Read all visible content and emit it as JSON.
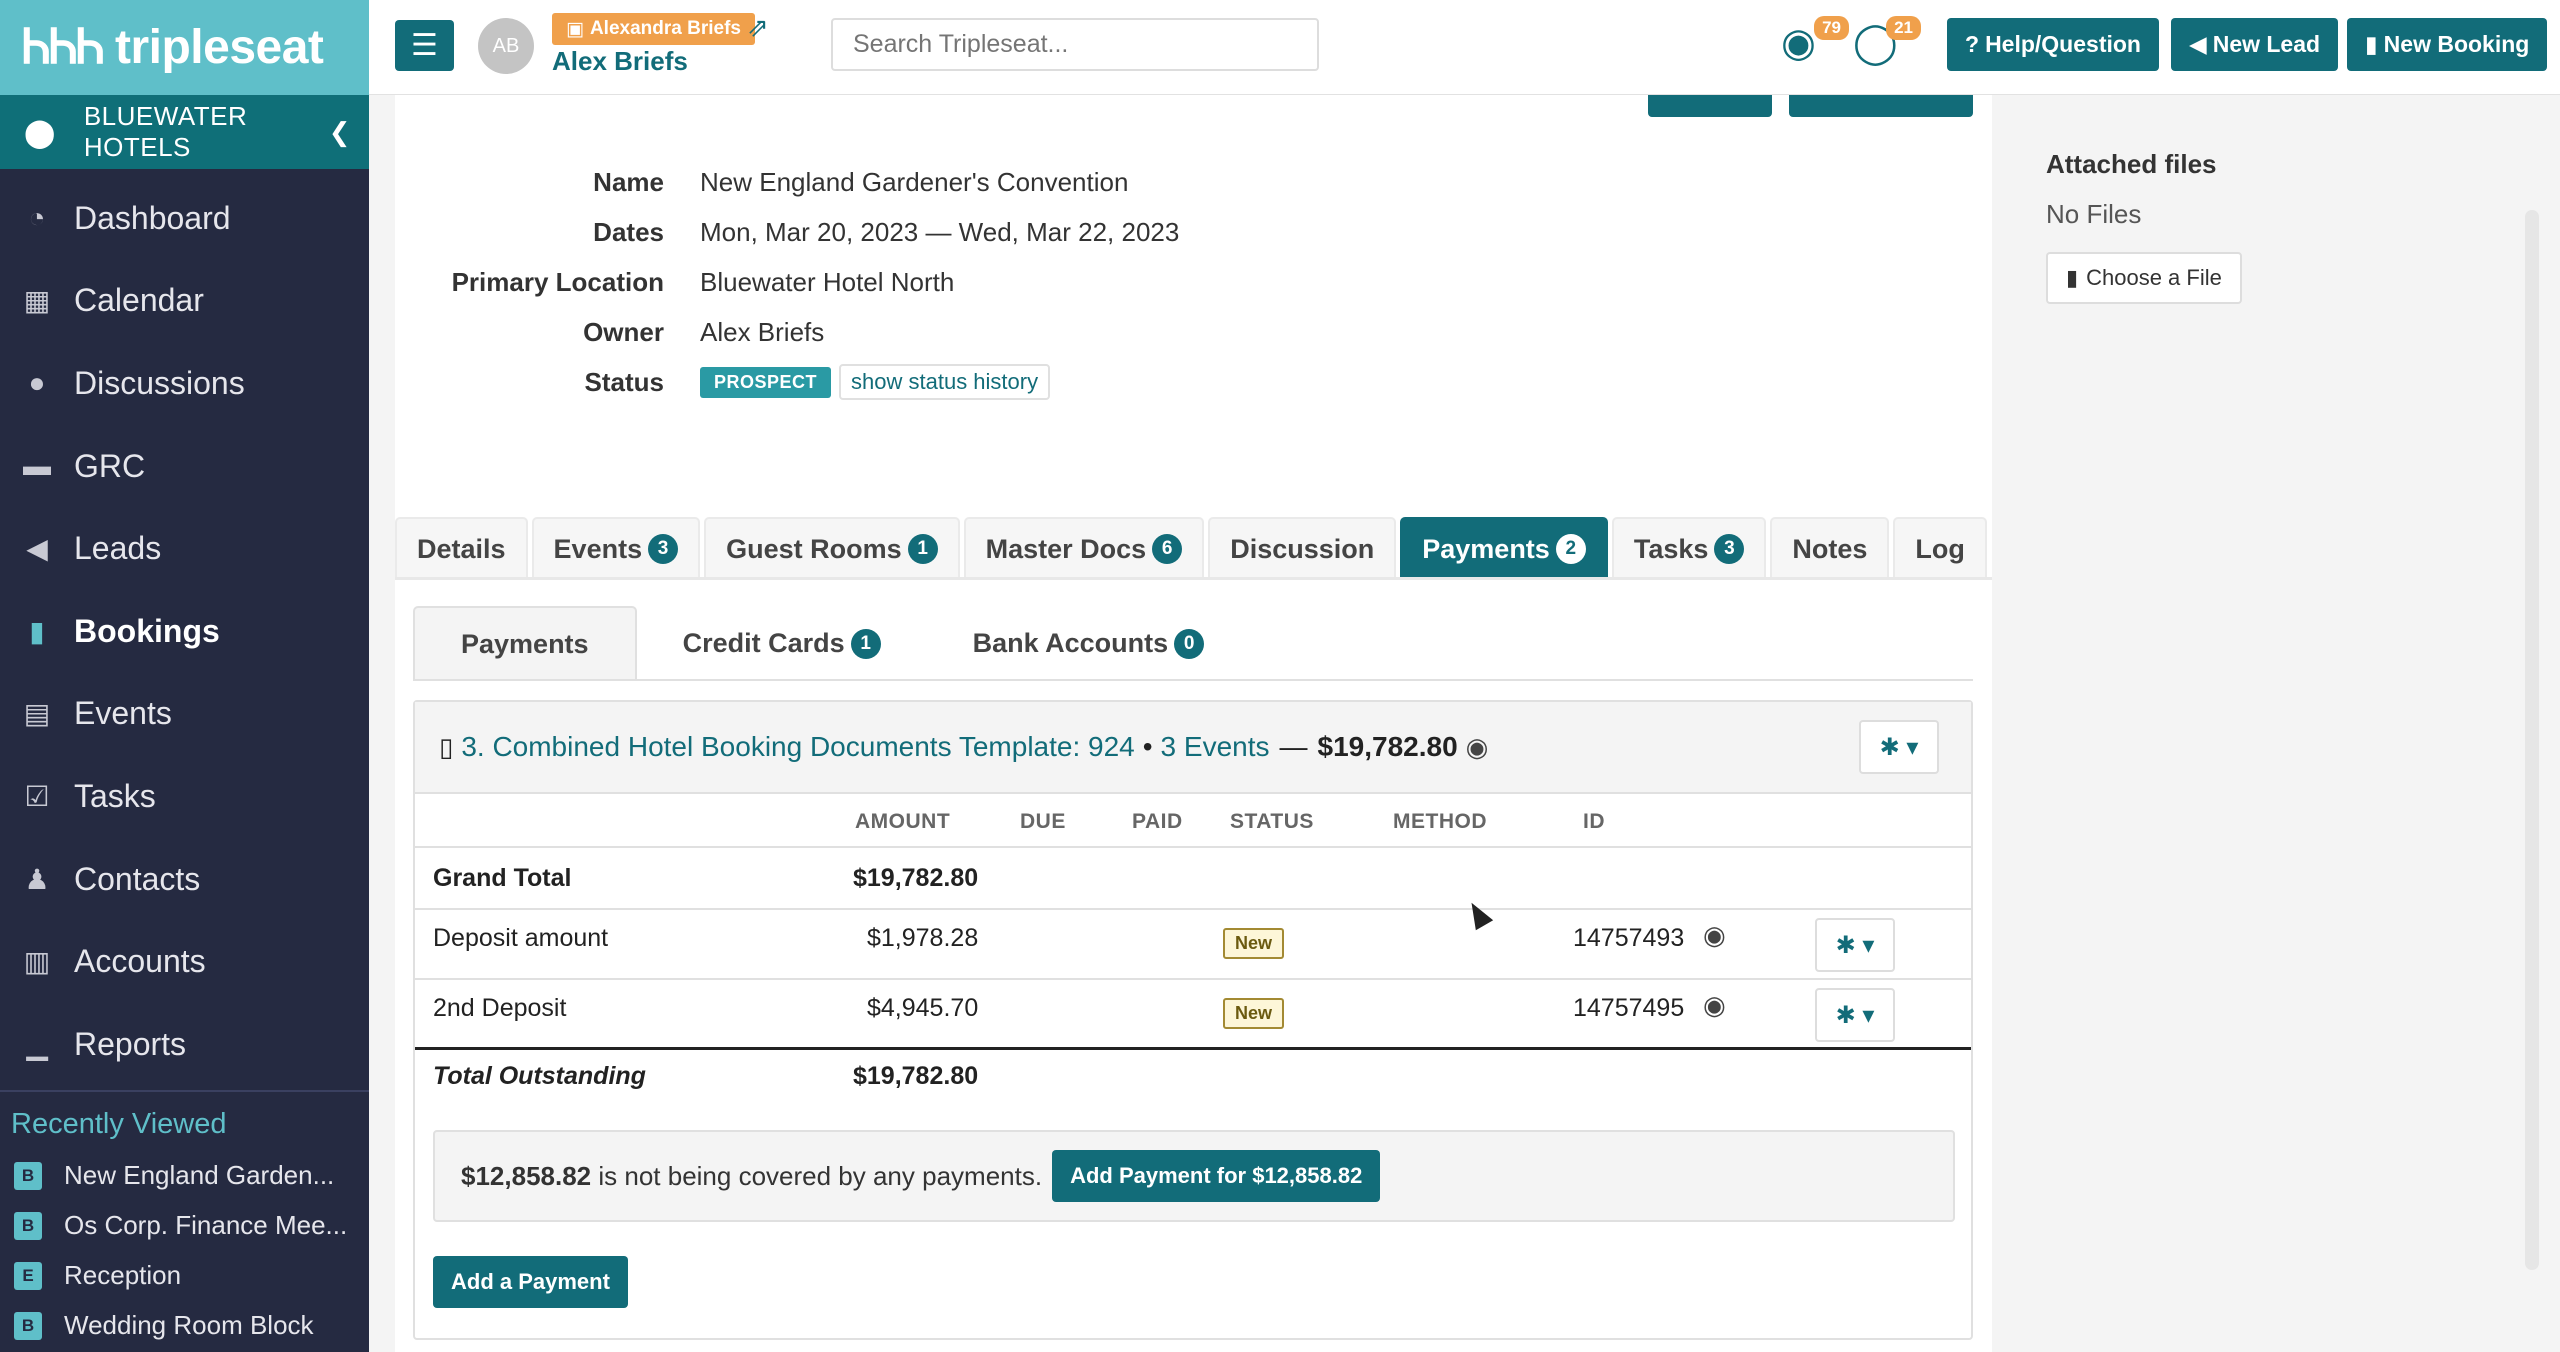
{
  "brand": {
    "logo_mark": "ᏂᏂᏂ",
    "logo_text": "tripleseat"
  },
  "sidebar": {
    "company": "BLUEWATER HOTELS",
    "items": [
      {
        "label": "Dashboard",
        "icon": "dashboard-icon",
        "glyph": "◔"
      },
      {
        "label": "Calendar",
        "icon": "calendar-icon",
        "glyph": "▦"
      },
      {
        "label": "Discussions",
        "icon": "comment-icon",
        "glyph": "●"
      },
      {
        "label": "GRC",
        "icon": "bed-icon",
        "glyph": "▬"
      },
      {
        "label": "Leads",
        "icon": "megaphone-icon",
        "glyph": "◀"
      },
      {
        "label": "Bookings",
        "icon": "bookmark-icon",
        "glyph": "▮"
      },
      {
        "label": "Events",
        "icon": "book-icon",
        "glyph": "▤"
      },
      {
        "label": "Tasks",
        "icon": "checkbox-icon",
        "glyph": "☑"
      },
      {
        "label": "Contacts",
        "icon": "users-icon",
        "glyph": "♟"
      },
      {
        "label": "Accounts",
        "icon": "building-icon",
        "glyph": "▥"
      },
      {
        "label": "Reports",
        "icon": "bar-chart-icon",
        "glyph": "▁"
      }
    ],
    "recent_title": "Recently Viewed",
    "recent": [
      {
        "tag": "B",
        "label": "New England Garden..."
      },
      {
        "tag": "B",
        "label": "Os Corp. Finance Mee..."
      },
      {
        "tag": "E",
        "label": "Reception"
      },
      {
        "tag": "B",
        "label": "Wedding Room Block"
      }
    ]
  },
  "topbar": {
    "avatar": "AB",
    "impersonating": "Alexandra Briefs",
    "user": "Alex Briefs",
    "search_placeholder": "Search Tripleseat...",
    "notif_globe": "79",
    "notif_chat": "21",
    "help_label": "Help/Question",
    "new_lead_label": "New Lead",
    "new_booking_label": "New Booking"
  },
  "booking": {
    "name_label": "Name",
    "name": "New England Gardener's Convention",
    "dates_label": "Dates",
    "dates": "Mon, Mar 20, 2023 — Wed, Mar 22, 2023",
    "location_label": "Primary Location",
    "location": "Bluewater Hotel North",
    "owner_label": "Owner",
    "owner": "Alex Briefs",
    "status_label": "Status",
    "status": "PROSPECT",
    "status_link": "show status history"
  },
  "files": {
    "title": "Attached files",
    "empty": "No Files",
    "choose": "Choose a File"
  },
  "tabs": [
    {
      "label": "Details",
      "count": ""
    },
    {
      "label": "Events",
      "count": "3"
    },
    {
      "label": "Guest Rooms",
      "count": "1"
    },
    {
      "label": "Master Docs",
      "count": "6"
    },
    {
      "label": "Discussion",
      "count": ""
    },
    {
      "label": "Payments",
      "count": "2",
      "active": true
    },
    {
      "label": "Tasks",
      "count": "3"
    },
    {
      "label": "Notes",
      "count": ""
    },
    {
      "label": "Log",
      "count": ""
    }
  ],
  "subtabs": [
    {
      "label": "Payments",
      "count": ""
    },
    {
      "label": "Credit Cards",
      "count": "1"
    },
    {
      "label": "Bank Accounts",
      "count": "0"
    }
  ],
  "payments": {
    "doc_title": "3. Combined Hotel Booking Documents Template: 924",
    "sep": "•",
    "events_link": "3 Events",
    "dash": "—",
    "doc_total": "$19,782.80",
    "headers": {
      "amount": "AMOUNT",
      "due": "DUE",
      "paid": "PAID",
      "status": "STATUS",
      "method": "METHOD",
      "id": "ID"
    },
    "grand_total_label": "Grand Total",
    "grand_total": "$19,782.80",
    "rows": [
      {
        "label": "Deposit amount",
        "amount": "$1,978.28",
        "status": "New",
        "id": "14757493"
      },
      {
        "label": "2nd Deposit",
        "amount": "$4,945.70",
        "status": "New",
        "id": "14757495"
      }
    ],
    "outstanding_label": "Total Outstanding",
    "outstanding": "$19,782.80",
    "uncovered_amount": "$12,858.82",
    "uncovered_text": " is not being covered by any payments.",
    "add_for_label": "Add Payment for $12,858.82",
    "add_payment_label": "Add a Payment"
  }
}
